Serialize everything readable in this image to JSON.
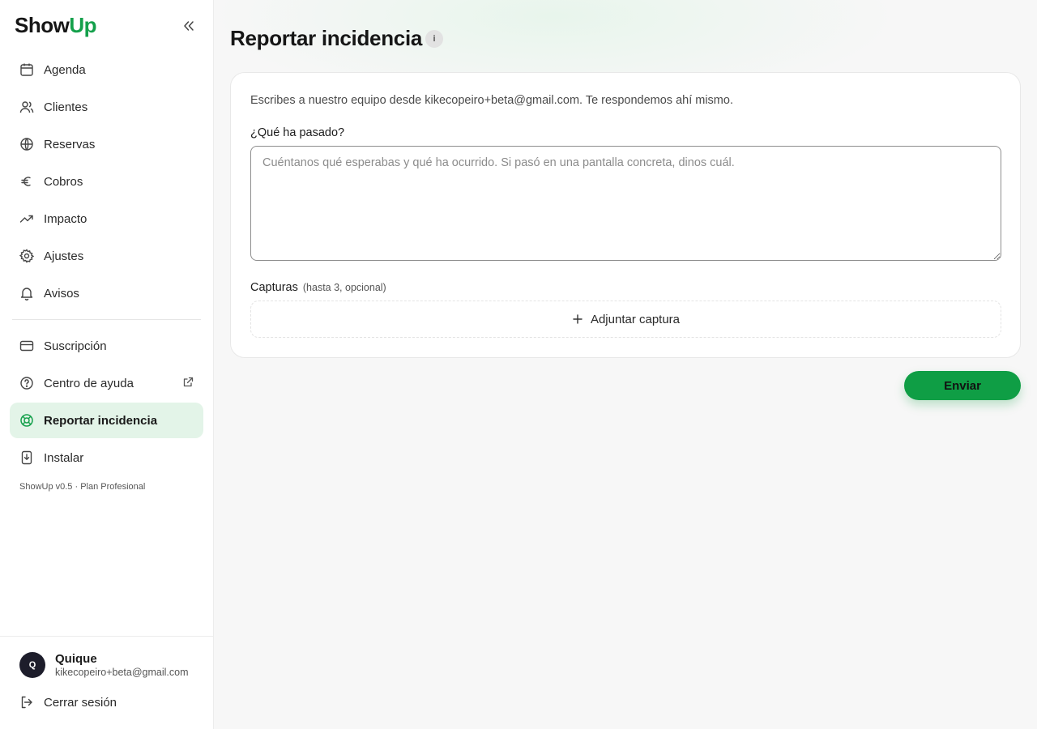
{
  "brand": {
    "name_part1": "Show",
    "name_part2": "Up",
    "accent_color": "#14a04b"
  },
  "sidebar": {
    "collapse_icon": "chevrons-left-icon",
    "items": [
      {
        "label": "Agenda",
        "icon": "calendar-icon"
      },
      {
        "label": "Clientes",
        "icon": "users-icon"
      },
      {
        "label": "Reservas",
        "icon": "globe-icon"
      },
      {
        "label": "Cobros",
        "icon": "euro-icon"
      },
      {
        "label": "Impacto",
        "icon": "trending-up-icon"
      },
      {
        "label": "Ajustes",
        "icon": "gear-icon"
      },
      {
        "label": "Avisos",
        "icon": "bell-icon"
      }
    ],
    "secondary_items": [
      {
        "label": "Suscripción",
        "icon": "credit-card-icon"
      },
      {
        "label": "Centro de ayuda",
        "icon": "help-circle-icon",
        "external": true
      },
      {
        "label": "Reportar incidencia",
        "icon": "lifebuoy-icon",
        "active": true
      },
      {
        "label": "Instalar",
        "icon": "install-icon"
      }
    ],
    "version_text": "ShowUp v0.5 · Plan Profesional",
    "active_bg_color": "#e3f4e8"
  },
  "user": {
    "initial": "Q",
    "name": "Quique",
    "email": "kikecopeiro+beta@gmail.com",
    "logout_label": "Cerrar sesión"
  },
  "page": {
    "title": "Reportar incidencia",
    "info_badge": "i",
    "intro_text": "Escribes a nuestro equipo desde kikecopeiro+beta@gmail.com. Te respondemos ahí mismo.",
    "question_label": "¿Qué ha pasado?",
    "textarea_value": "",
    "textarea_placeholder": "Cuéntanos qué esperabas y qué ha ocurrido. Si pasó en una pantalla concreta, dinos cuál.",
    "captures_label": "Capturas",
    "captures_hint": "(hasta 3, opcional)",
    "attach_label": "Adjuntar captura",
    "submit_label": "Enviar",
    "submit_color": "#0f9e45"
  }
}
